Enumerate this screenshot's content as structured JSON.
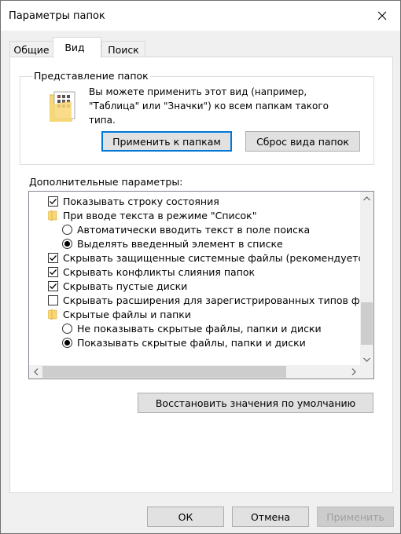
{
  "window": {
    "title": "Параметры папок"
  },
  "tabs": [
    {
      "label": "Общие"
    },
    {
      "label": "Вид"
    },
    {
      "label": "Поиск"
    }
  ],
  "folder_views": {
    "legend": "Представление папок",
    "description": "Вы можете применить этот вид (например, \"Таблица\" или \"Значки\") ко всем папкам такого типа.",
    "apply_button": "Применить к папкам",
    "reset_button": "Сброс вида папок"
  },
  "advanced": {
    "label": "Дополнительные параметры:",
    "items": [
      {
        "type": "checkbox",
        "checked": true,
        "label": "Показывать строку состояния"
      },
      {
        "type": "folder",
        "label": "При вводе текста в режиме \"Список\""
      },
      {
        "type": "radio",
        "selected": false,
        "label": "Автоматически вводить текст в поле поиска"
      },
      {
        "type": "radio",
        "selected": true,
        "label": "Выделять введенный элемент в списке"
      },
      {
        "type": "checkbox",
        "checked": true,
        "label": "Скрывать защищенные системные файлы (рекомендуетс"
      },
      {
        "type": "checkbox",
        "checked": true,
        "label": "Скрывать конфликты слияния папок"
      },
      {
        "type": "checkbox",
        "checked": true,
        "label": "Скрывать пустые диски"
      },
      {
        "type": "checkbox",
        "checked": false,
        "label": "Скрывать расширения для зарегистрированных типов фа"
      },
      {
        "type": "folder",
        "label": "Скрытые файлы и папки"
      },
      {
        "type": "radio",
        "selected": false,
        "label": "Не показывать скрытые файлы, папки и диски"
      },
      {
        "type": "radio",
        "selected": true,
        "label": "Показывать скрытые файлы, папки и диски"
      }
    ]
  },
  "restore_button": "Восстановить значения по умолчанию",
  "footer": {
    "ok": "ОК",
    "cancel": "Отмена",
    "apply": "Применить"
  },
  "colors": {
    "accent": "#0078d7",
    "folder": "#f8d775"
  }
}
